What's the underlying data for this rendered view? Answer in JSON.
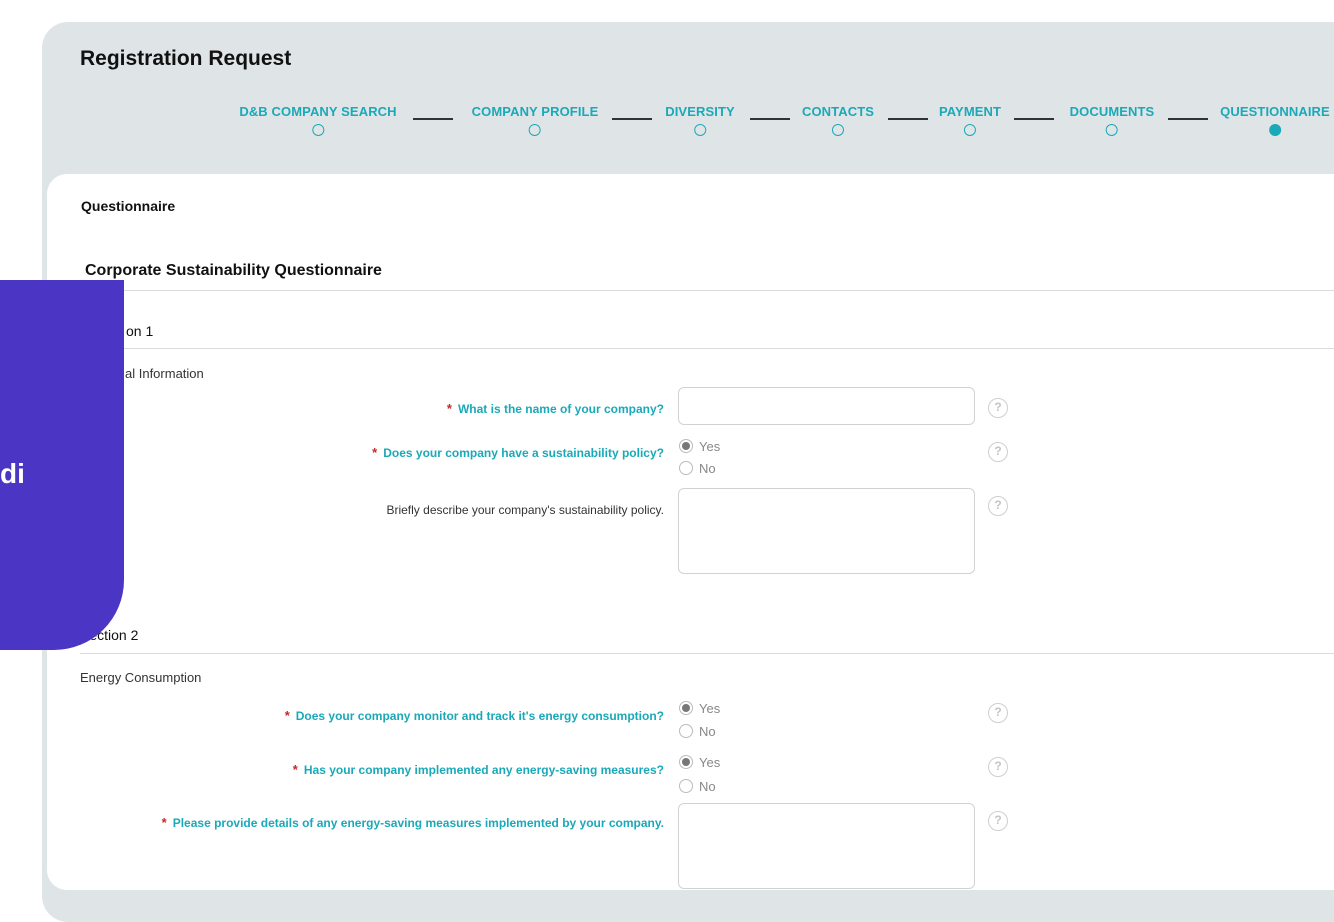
{
  "header": {
    "title": "Registration Request"
  },
  "steps": [
    {
      "label": "D&B COMPANY SEARCH",
      "active": false
    },
    {
      "label": "COMPANY PROFILE",
      "active": false
    },
    {
      "label": "DIVERSITY",
      "active": false
    },
    {
      "label": "CONTACTS",
      "active": false
    },
    {
      "label": "PAYMENT",
      "active": false
    },
    {
      "label": "DOCUMENTS",
      "active": false
    },
    {
      "label": "QUESTIONNAIRE",
      "active": true
    }
  ],
  "page": {
    "section_title": "Questionnaire",
    "questionnaire_title": "Corporate Sustainability Questionnaire"
  },
  "section1": {
    "title": "Section 1",
    "title_visible": "on 1",
    "subtitle": "General Information",
    "subtitle_visible": "al Information",
    "questions": [
      {
        "label": "What is the name of your company?",
        "required": true,
        "value": "",
        "help": "?"
      },
      {
        "label": "Does your company have a sustainability policy?",
        "required": true,
        "options": [
          "Yes",
          "No"
        ],
        "selected": "Yes",
        "help": "?"
      },
      {
        "label": "Briefly describe your company's sustainability policy.",
        "required": false,
        "value": "",
        "help": "?"
      }
    ]
  },
  "section2": {
    "title": "Section 2",
    "subtitle": "Energy Consumption",
    "questions": [
      {
        "label": "Does your company monitor and track it's energy consumption?",
        "required": true,
        "options": [
          "Yes",
          "No"
        ],
        "selected": "Yes",
        "help": "?"
      },
      {
        "label": "Has your company implemented any energy-saving measures?",
        "required": true,
        "options": [
          "Yes",
          "No"
        ],
        "selected": "Yes",
        "help": "?"
      },
      {
        "label": "Please provide details of any energy-saving measures implemented by your company.",
        "required": true,
        "value": "",
        "help": "?"
      }
    ]
  },
  "overlay": {
    "text": "di",
    "color": "#4a35c4"
  },
  "colors": {
    "accent": "#1aa9b8",
    "required": "#c62828",
    "header_bg": "#dfe5e6"
  }
}
